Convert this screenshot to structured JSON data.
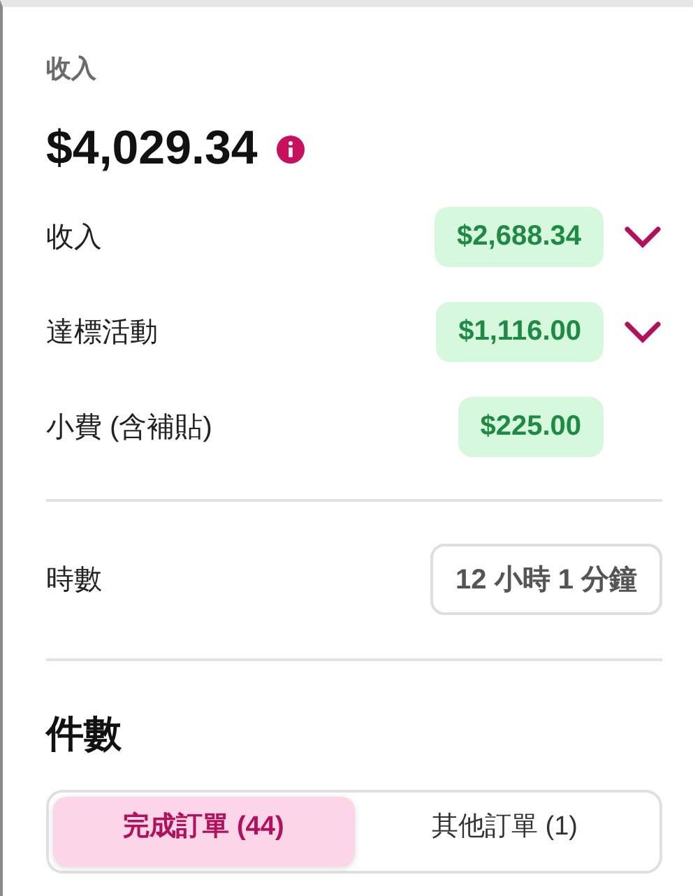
{
  "earnings": {
    "label": "收入",
    "total": "$4,029.34"
  },
  "breakdown": [
    {
      "label": "收入",
      "amount": "$2,688.34",
      "expandable": true
    },
    {
      "label": "達標活動",
      "amount": "$1,116.00",
      "expandable": true
    },
    {
      "label": "小費 (含補貼)",
      "amount": "$225.00",
      "expandable": false
    }
  ],
  "hours": {
    "label": "時數",
    "value": "12 小時 1 分鐘"
  },
  "orders": {
    "title": "件數",
    "tabs": [
      {
        "label": "完成訂單 (44)",
        "selected": true
      },
      {
        "label": "其他訂單 (1)",
        "selected": false
      }
    ]
  }
}
